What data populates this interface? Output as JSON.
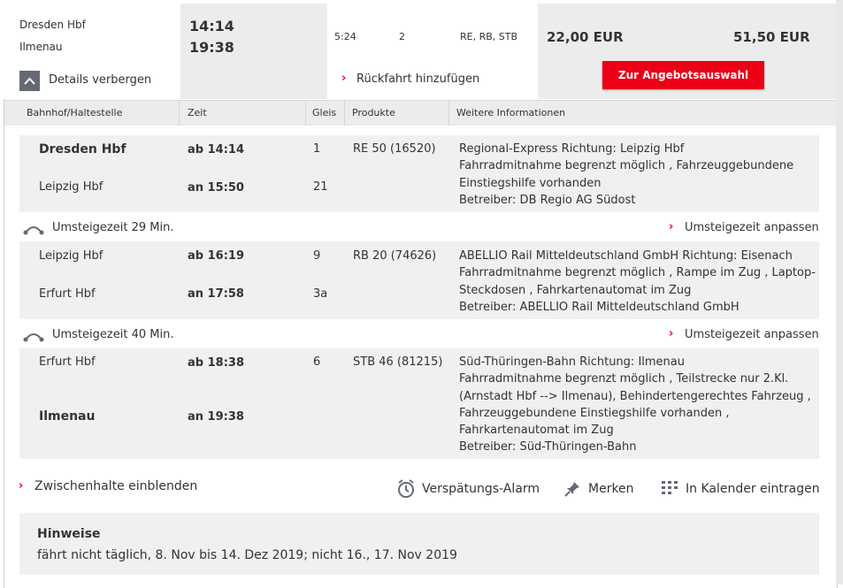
{
  "summary": {
    "from_station": "Dresden Hbf",
    "to_station": "Ilmenau",
    "dep_time": "14:14",
    "arr_time": "19:38",
    "duration": "5:24",
    "changes": "2",
    "products": "RE, RB, STB",
    "price_1": "22,00 EUR",
    "price_2": "51,50 EUR",
    "details_toggle": "Details verbergen",
    "return_link": "Rückfahrt hinzufügen",
    "offer_button": "Zur Angebotsauswahl"
  },
  "table_headers": {
    "station": "Bahnhof/Haltestelle",
    "time": "Zeit",
    "platform": "Gleis",
    "products": "Produkte",
    "info": "Weitere Informationen"
  },
  "segments": [
    {
      "from": "Dresden Hbf",
      "dep": "ab 14:14",
      "dep_platform": "1",
      "product": "RE 50 (16520)",
      "to": "Leipzig Hbf",
      "arr": "an 15:50",
      "arr_platform": "21",
      "info": [
        "Regional-Express Richtung: Leipzig Hbf",
        "Fahrradmitnahme begrenzt möglich , Fahrzeuggebundene",
        "Einstiegshilfe vorhanden",
        "Betreiber: DB Regio AG Südost"
      ]
    },
    {
      "from": "Leipzig Hbf",
      "dep": "ab 16:19",
      "dep_platform": "9",
      "product": "RB 20 (74626)",
      "to": "Erfurt Hbf",
      "arr": "an 17:58",
      "arr_platform": "3a",
      "info": [
        "ABELLIO Rail Mitteldeutschland GmbH Richtung: Eisenach",
        "Fahrradmitnahme begrenzt möglich , Rampe im Zug , Laptop-",
        "Steckdosen , Fahrkartenautomat im Zug",
        "Betreiber: ABELLIO Rail Mitteldeutschland GmbH"
      ]
    },
    {
      "from": "Erfurt Hbf",
      "dep": "ab 18:38",
      "dep_platform": "6",
      "product": "STB 46 (81215)",
      "to": "Ilmenau",
      "arr": "an 19:38",
      "arr_platform": "",
      "info": [
        "Süd-Thüringen-Bahn Richtung: Ilmenau",
        "Fahrradmitnahme begrenzt möglich , Teilstrecke nur 2.Kl.",
        "(Arnstadt Hbf --> Ilmenau), Behindertengerechtes Fahrzeug ,",
        "Fahrzeuggebundene Einstiegshilfe vorhanden ,",
        "Fahrkartenautomat im Zug",
        "Betreiber: Süd-Thüringen-Bahn"
      ]
    }
  ],
  "transfers": [
    {
      "label": "Umsteigezeit 29 Min.",
      "adjust": "Umsteigezeit anpassen"
    },
    {
      "label": "Umsteigezeit 40 Min.",
      "adjust": "Umsteigezeit anpassen"
    }
  ],
  "actions": {
    "stops": "Zwischenhalte einblenden",
    "alarm": "Verspätungs-Alarm",
    "remember": "Merken",
    "calendar": "In Kalender eintragen"
  },
  "hints": {
    "title": "Hinweise",
    "text": "fährt nicht täglich, 8. Nov bis 14. Dez 2019; nicht 16., 17. Nov 2019"
  },
  "colors": {
    "accent": "#ec0016",
    "panel": "#f0f0f0",
    "header": "#ececec",
    "toggle": "#646973"
  }
}
